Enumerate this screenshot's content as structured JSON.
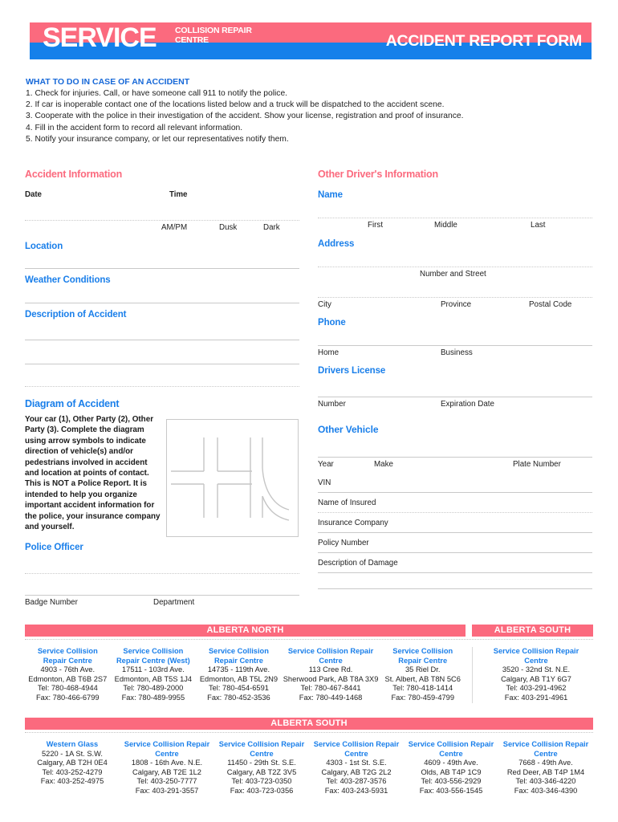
{
  "masthead": {
    "brand_main": "SERVICE",
    "brand_sub": "COLLISION REPAIR CENTRE",
    "form_title": "ACCIDENT REPORT FORM",
    "pink": "#fb6a7e",
    "blue": "#1580ea"
  },
  "instructions": {
    "title": "WHAT TO DO IN CASE OF AN ACCIDENT",
    "items": [
      "1. Check for injuries. Call, or have someone call 911 to notify the police.",
      "2. If car is inoperable contact one of the locations listed below and a truck will be dispatched to the accident scene.",
      "3. Cooperate with the police in their investigation of the accident. Show your license, registration and proof of insurance.",
      "4. Fill in the accident form to record all relevant information.",
      "5. Notify your insurance company, or let our representatives notify them."
    ]
  },
  "accident_information": {
    "section_title": "Accident Information",
    "date_label": "Date",
    "time_label": "Time",
    "ampm_label": "AM/PM",
    "dusk_label": "Dusk",
    "dark_label": "Dark",
    "location_label": "Location",
    "weather_label": "Weather Conditions",
    "description_label": "Description of Accident"
  },
  "diagram": {
    "section_title": "Diagram of Accident",
    "body": "Your car (1), Other Party (2), Other Party (3). Complete the diagram using arrow symbols to indicate direction of vehicle(s) and/or pedestrians involved in accident and location at points of contact. This is NOT a Police Report. It is intended to help you organize important accident information for the police, your insurance company and yourself."
  },
  "police": {
    "section_title": "Police Officer",
    "badge_label": "Badge Number",
    "department_label": "Department"
  },
  "other_driver": {
    "section_title": "Other Driver's Information",
    "name_label": "Name",
    "first_label": "First",
    "middle_label": "Middle",
    "last_label": "Last",
    "address_label": "Address",
    "number_street_label": "Number and Street",
    "city_label": "City",
    "province_label": "Province",
    "postal_label": "Postal Code",
    "phone_label": "Phone",
    "home_label": "Home",
    "business_label": "Business",
    "license_label": "Drivers License",
    "license_number_label": "Number",
    "expiration_label": "Expiration Date"
  },
  "other_vehicle": {
    "section_title": "Other Vehicle",
    "year_label": "Year",
    "make_label": "Make",
    "plate_label": "Plate Number",
    "vin_label": "VIN",
    "insured_label": "Name of Insured",
    "insurance_company_label": "Insurance Company",
    "policy_label": "Policy Number",
    "damage_label": "Description of Damage"
  },
  "locations": {
    "north_banner": "ALBERTA NORTH",
    "south_banner_top": "ALBERTA SOUTH",
    "south_banner_bottom": "ALBERTA SOUTH",
    "north": [
      {
        "name": "Service Collision Repair Centre",
        "address": "4903 - 76th Ave.",
        "city": "Edmonton, AB  T6B 2S7",
        "tel": "Tel: 780-468-4944",
        "fax": "Fax: 780-466-6799"
      },
      {
        "name": "Service Collision Repair Centre (West)",
        "address": "17511 - 103rd Ave.",
        "city": "Edmonton, AB  T5S 1J4",
        "tel": "Tel: 780-489-2000",
        "fax": "Fax: 780-489-9955"
      },
      {
        "name": "Service Collision Repair Centre",
        "address": "14735 - 119th Ave.",
        "city": "Edmonton, AB  T5L 2N9",
        "tel": "Tel: 780-454-6591",
        "fax": "Fax: 780-452-3536"
      },
      {
        "name": "Service Collision Repair Centre",
        "address": "113 Cree Rd.",
        "city": "Sherwood Park, AB  T8A 3X9",
        "tel": "Tel: 780-467-8441",
        "fax": "Fax: 780-449-1468"
      },
      {
        "name": "Service Collision Repair Centre",
        "address": "35 Riel Dr.",
        "city": "St. Albert, AB  T8N 5C6",
        "tel": "Tel: 780-418-1414",
        "fax": "Fax: 780-459-4799"
      }
    ],
    "south_top": [
      {
        "name": "Service Collision Repair Centre",
        "address": "3520 - 32nd St. N.E.",
        "city": "Calgary, AB  T1Y 6G7",
        "tel": "Tel: 403-291-4962",
        "fax": "Fax: 403-291-4961"
      }
    ],
    "south_bottom": [
      {
        "name": "Western Glass",
        "address": "5220 - 1A St. S.W.",
        "city": "Calgary, AB  T2H 0E4",
        "tel": "Tel: 403-252-4279",
        "fax": "Fax: 403-252-4975"
      },
      {
        "name": "Service Collision Repair Centre",
        "address": "1808 - 16th Ave. N.E.",
        "city": "Calgary, AB  T2E 1L2",
        "tel": "Tel: 403-250-7777",
        "fax": "Fax: 403-291-3557"
      },
      {
        "name": "Service Collision Repair Centre",
        "address": "11450 - 29th St. S.E.",
        "city": "Calgary, AB  T2Z 3V5",
        "tel": "Tel: 403-723-0350",
        "fax": "Fax: 403-723-0356"
      },
      {
        "name": "Service Collision Repair Centre",
        "address": "4303 - 1st St. S.E.",
        "city": "Calgary, AB  T2G 2L2",
        "tel": "Tel: 403-287-3576",
        "fax": "Fax: 403-243-5931"
      },
      {
        "name": "Service Collision Repair Centre",
        "address": "4609 - 49th Ave.",
        "city": "Olds, AB  T4P 1C9",
        "tel": "Tel: 403-556-2929",
        "fax": "Fax: 403-556-1545"
      },
      {
        "name": "Service Collision Repair Centre",
        "address": "7668 - 49th Ave.",
        "city": "Red Deer, AB  T4P 1M4",
        "tel": "Tel: 403-346-4220",
        "fax": "Fax: 403-346-4390"
      }
    ]
  }
}
